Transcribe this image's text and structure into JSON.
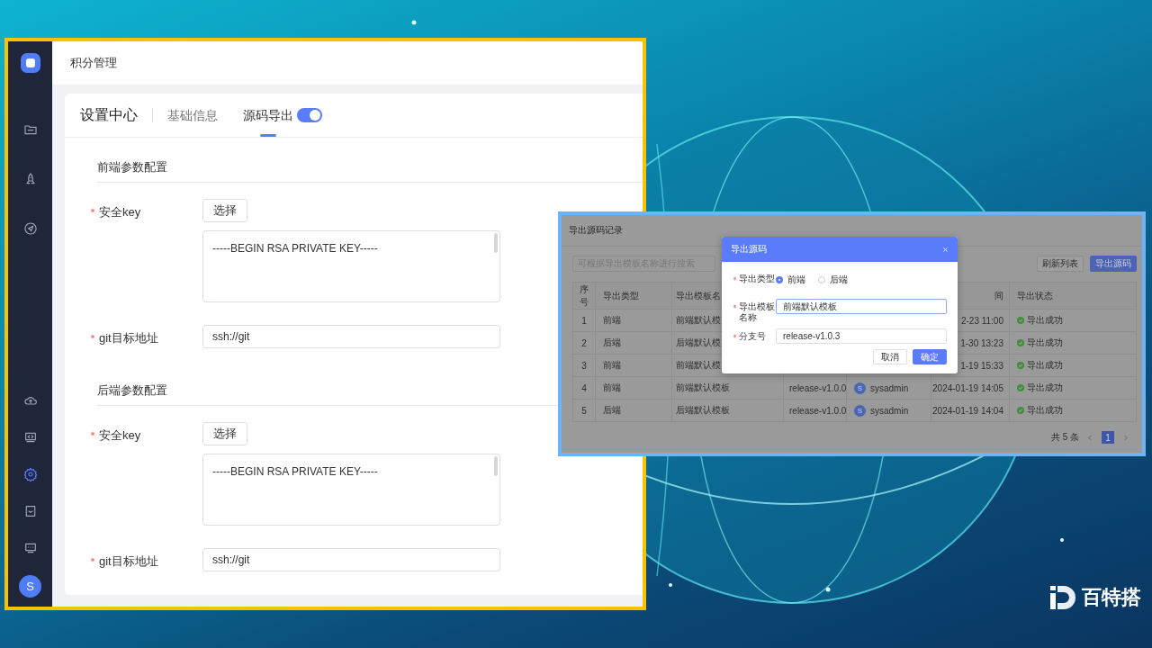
{
  "settings_window": {
    "sidebar": {
      "items": [
        {
          "selected": false
        },
        {
          "selected": false
        },
        {
          "selected": false
        },
        {
          "selected": false
        },
        {
          "selected": false
        },
        {
          "selected": true
        },
        {
          "selected": false
        },
        {
          "selected": false
        }
      ],
      "avatar": "S"
    },
    "header": {
      "title": "积分管理"
    },
    "tabs": {
      "title": "设置中心",
      "items": [
        {
          "label": "基础信息",
          "selected": false
        },
        {
          "label": "源码导出",
          "selected": true
        }
      ],
      "toggle": {
        "on": true
      }
    },
    "sections": [
      {
        "title": "前端参数配置",
        "key": {
          "label": "安全key",
          "required": true,
          "button": "选择",
          "value": "-----BEGIN RSA PRIVATE KEY-----"
        },
        "git": {
          "label": "git目标地址",
          "required": true,
          "value": "ssh://git"
        }
      },
      {
        "title": "后端参数配置",
        "key": {
          "label": "安全key",
          "required": true,
          "button": "选择",
          "value": "-----BEGIN RSA PRIVATE KEY-----"
        },
        "git": {
          "label": "git目标地址",
          "required": true,
          "value": "ssh://git"
        }
      }
    ]
  },
  "export_window": {
    "title": "导出源码记录",
    "search": {
      "placeholder": "可根据导出模板名称进行搜索"
    },
    "buttons": [
      {
        "label": "刷新列表",
        "primary": false
      },
      {
        "label": "导出源码",
        "primary": true
      }
    ],
    "table": {
      "header": {
        "index": "序号",
        "type": "导出类型",
        "template": "导出模板名",
        "time": "间",
        "status": "导出状态"
      },
      "rows": [
        {
          "index": "1",
          "type": "前端",
          "template": "前端默认模",
          "time": "2-23 11:00",
          "status": "导出成功"
        },
        {
          "index": "2",
          "type": "后端",
          "template": "后端默认模",
          "time": "1-30 13:23",
          "status": "导出成功"
        },
        {
          "index": "3",
          "type": "前端",
          "template": "前端默认模",
          "time": "1-19 15:33",
          "status": "导出成功"
        },
        {
          "index": "4",
          "type": "前端",
          "template": "前端默认模板",
          "branch": "release-v1.0.0",
          "avatar": "S",
          "user": "sysadmin",
          "time": "2024-01-19 14:05",
          "status": "导出成功"
        },
        {
          "index": "5",
          "type": "后端",
          "template": "后端默认模板",
          "branch": "release-v1.0.0",
          "avatar": "S",
          "user": "sysadmin",
          "time": "2024-01-19 14:04",
          "status": "导出成功"
        }
      ]
    },
    "pagination": {
      "total": "共 5 条",
      "pages": [
        {
          "label": "1",
          "selected": true
        }
      ]
    },
    "dialog": {
      "title": "导出源码",
      "fields": [
        {
          "kind": "radio",
          "label": "导出类型",
          "required": true,
          "options": [
            {
              "label": "前端",
              "selected": true
            },
            {
              "label": "后端",
              "selected": false
            }
          ]
        },
        {
          "kind": "select",
          "label": "导出模板名称",
          "required": true,
          "value": "前端默认模板"
        },
        {
          "kind": "input",
          "label": "分支号",
          "required": true,
          "value": "release-v1.0.3"
        }
      ],
      "buttons": [
        {
          "label": "取消",
          "primary": false
        },
        {
          "label": "确定",
          "primary": true
        }
      ]
    }
  },
  "brand": {
    "name": "百特搭"
  }
}
